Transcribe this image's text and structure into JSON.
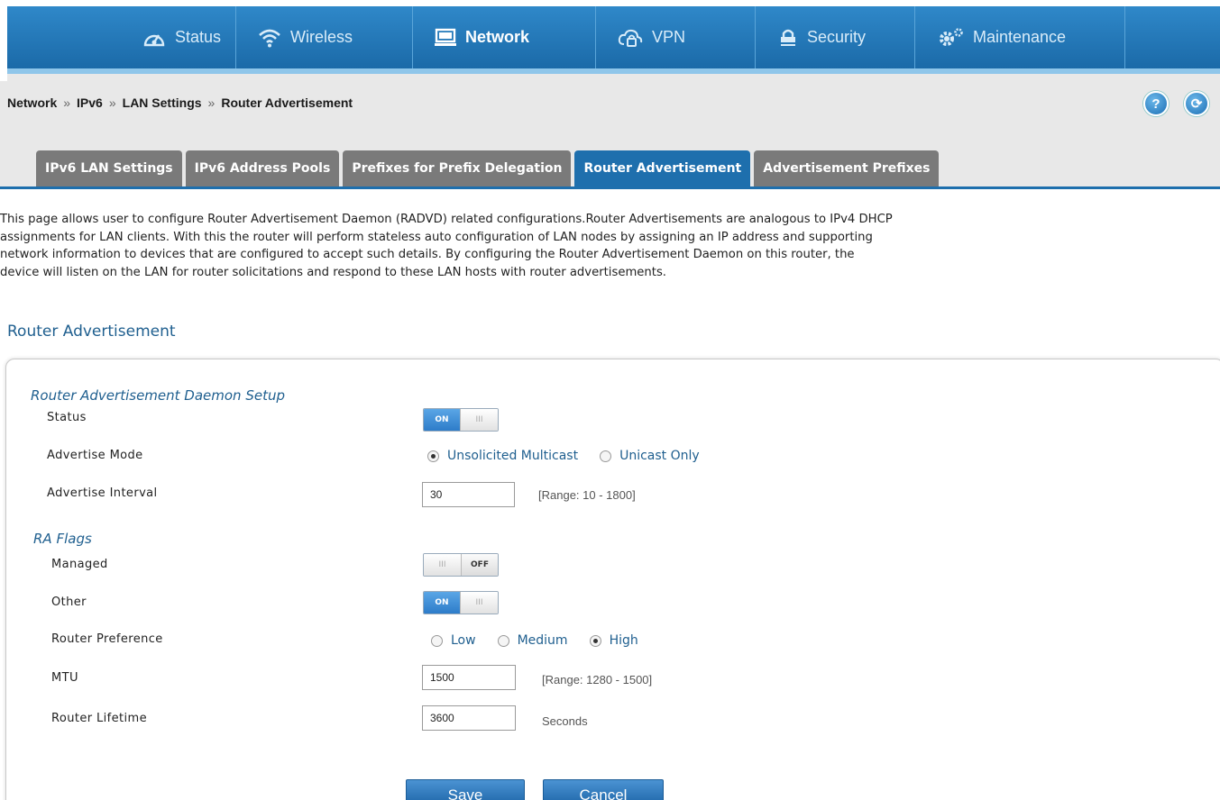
{
  "nav": {
    "items": [
      {
        "label": "Status",
        "icon": "gauge-icon"
      },
      {
        "label": "Wireless",
        "icon": "wifi-icon"
      },
      {
        "label": "Network",
        "icon": "monitor-icon",
        "active": true
      },
      {
        "label": "VPN",
        "icon": "cloud-lock-icon"
      },
      {
        "label": "Security",
        "icon": "padlock-icon"
      },
      {
        "label": "Maintenance",
        "icon": "gears-icon"
      }
    ]
  },
  "breadcrumb": [
    "Network",
    "IPv6",
    "LAN Settings",
    "Router Advertisement"
  ],
  "breadcrumb_sep": "»",
  "help_button": "?",
  "logout_button": "⟳",
  "tabs": [
    {
      "label": "IPv6 LAN Settings"
    },
    {
      "label": "IPv6 Address Pools"
    },
    {
      "label": "Prefixes for Prefix Delegation"
    },
    {
      "label": "Router Advertisement",
      "active": true
    },
    {
      "label": "Advertisement Prefixes"
    }
  ],
  "intro": [
    "This page allows user to configure Router Advertisement Daemon (RADVD) related configurations.Router Advertisements are analogous to IPv4 DHCP",
    "assignments for LAN clients. With this the router will perform stateless auto configuration of LAN nodes by assigning an IP address and supporting",
    "network information to devices that are configured to accept such details. By configuring the Router Advertisement Daemon on this router, the",
    "device will listen on the LAN for router solicitations and respond to these LAN hosts with router advertisements."
  ],
  "section_title": "Router Advertisement",
  "daemon": {
    "title": "Router Advertisement Daemon Setup",
    "status_label": "Status",
    "status_on_text": "ON",
    "status_grip": "III",
    "advertise_mode_label": "Advertise Mode",
    "advertise_mode_options": [
      "Unsolicited Multicast",
      "Unicast Only"
    ],
    "advertise_mode_selected": "Unsolicited Multicast",
    "interval_label": "Advertise Interval",
    "interval_value": "30",
    "interval_hint": "[Range: 10 - 1800]"
  },
  "ra_flags": {
    "title": "RA Flags",
    "managed_label": "Managed",
    "managed_off_text": "OFF",
    "managed_grip": "III",
    "other_label": "Other",
    "other_on_text": "ON",
    "other_grip": "III",
    "pref_label": "Router Preference",
    "pref_options": [
      "Low",
      "Medium",
      "High"
    ],
    "pref_selected": "High",
    "mtu_label": "MTU",
    "mtu_value": "1500",
    "mtu_hint": "[Range: 1280 - 1500]",
    "lifetime_label": "Router Lifetime",
    "lifetime_value": "3600",
    "lifetime_hint": "Seconds"
  },
  "buttons": {
    "save": "Save",
    "cancel": "Cancel"
  }
}
